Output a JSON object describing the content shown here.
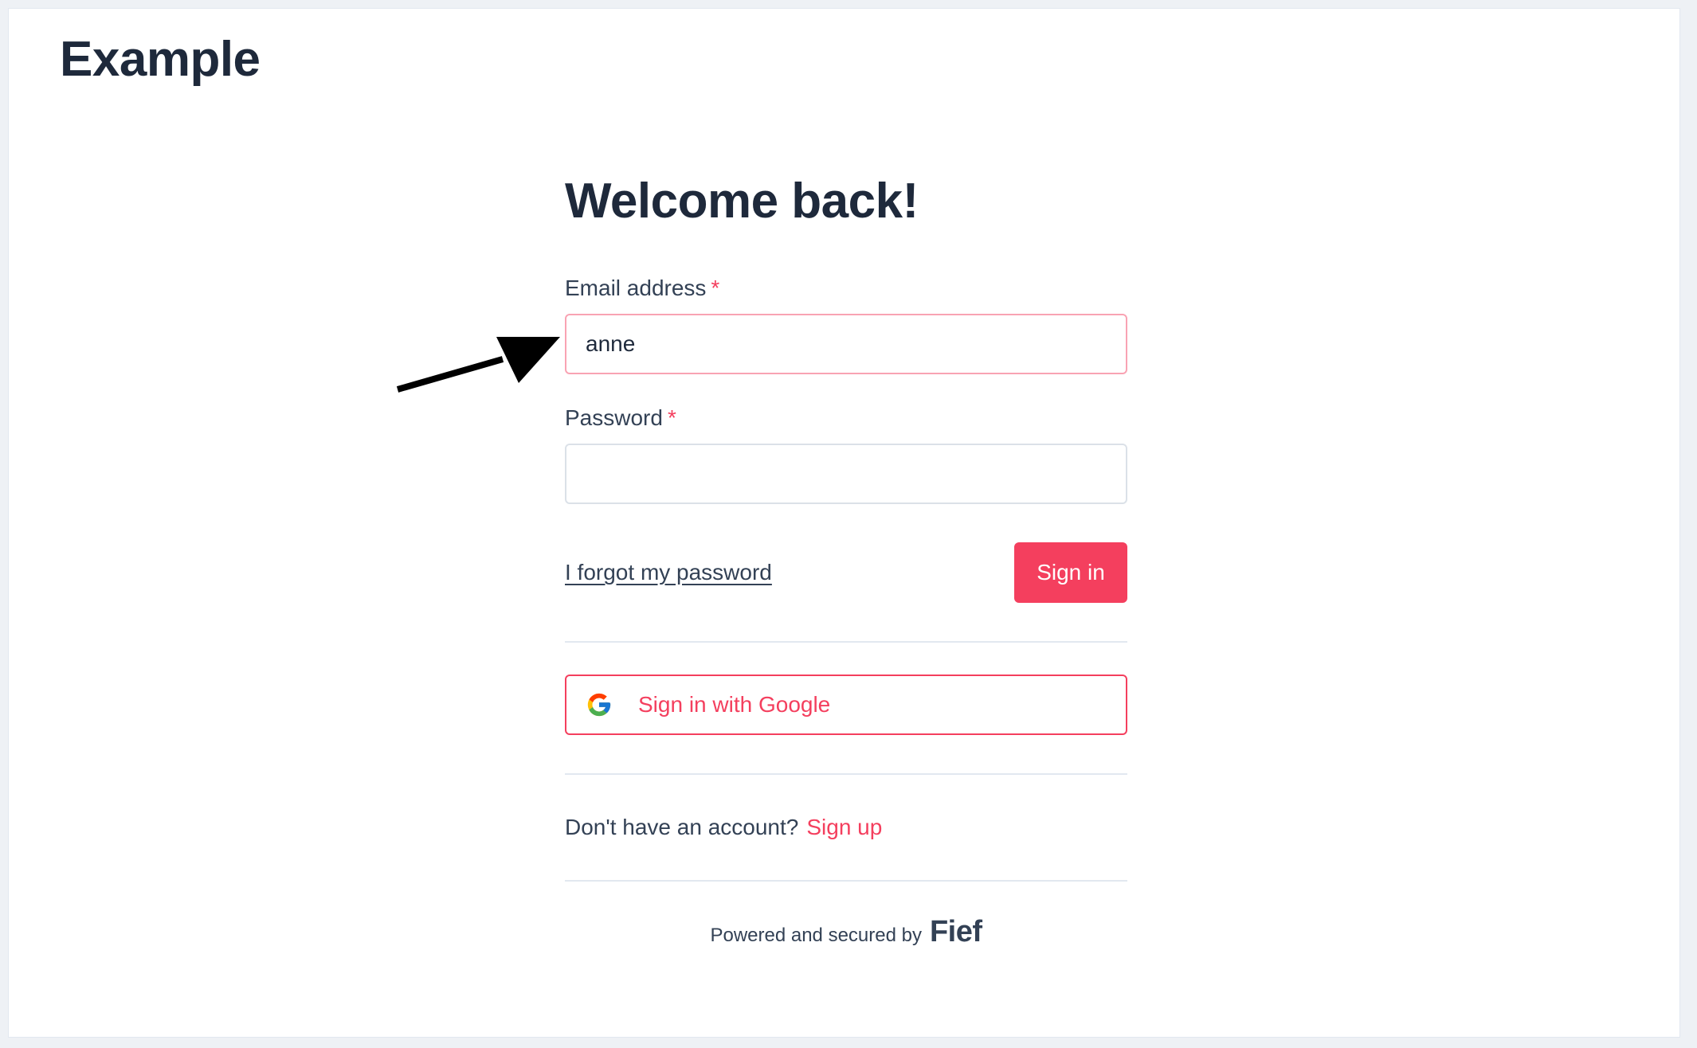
{
  "header": {
    "brand": "Example"
  },
  "form": {
    "title": "Welcome back!",
    "email": {
      "label": "Email address",
      "required_mark": "*",
      "value": "anne"
    },
    "password": {
      "label": "Password",
      "required_mark": "*",
      "value": ""
    },
    "forgot_link": "I forgot my password",
    "submit_label": "Sign in",
    "google_button_label": "Sign in with Google",
    "signup_prompt": "Don't have an account?",
    "signup_link": "Sign up"
  },
  "footer": {
    "powered_text": "Powered and secured by",
    "logo_text": "Fief"
  },
  "icons": {
    "annotation": "arrow-icon",
    "google": "google-icon"
  },
  "colors": {
    "accent": "#f43f5e",
    "text_dark": "#1e293b",
    "text_muted": "#334155",
    "error_border": "#f9a3b3",
    "border": "#dbe1e8"
  }
}
